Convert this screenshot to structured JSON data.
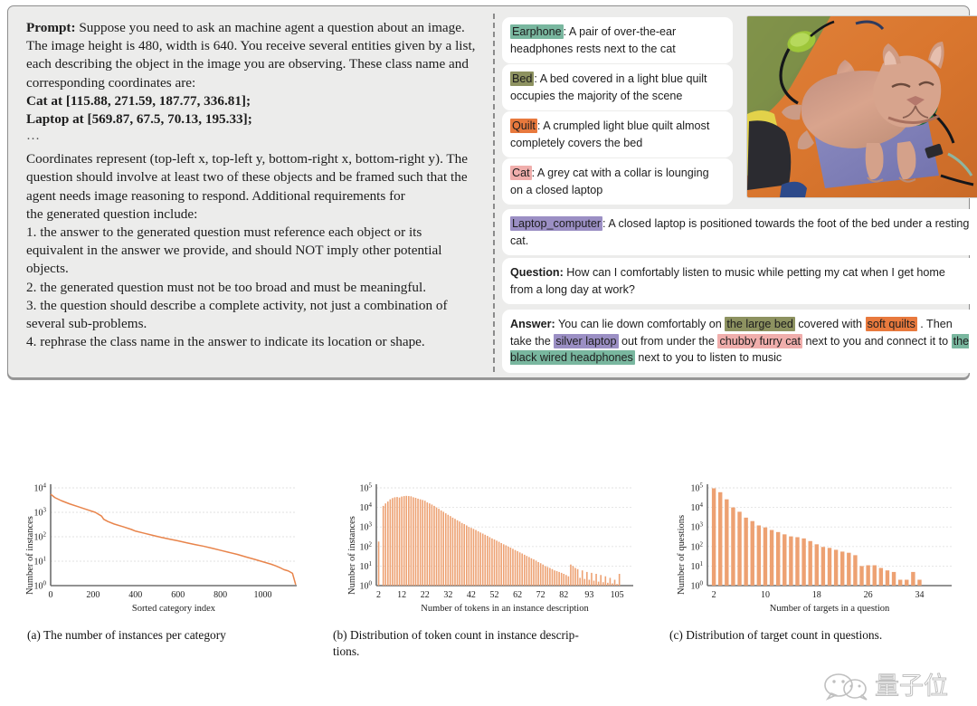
{
  "prompt": {
    "label": "Prompt:",
    "intro": " Suppose you need to ask an machine agent a question about an image. The image height is 480, width is 640. You receive several entities given by a list, each describing the object in the image you are observing. These class name and corresponding coordinates are:",
    "entity_lines": [
      "Cat at [115.88, 271.59, 187.77, 336.81];",
      "Laptop at [569.87, 67.5, 70.13, 195.33];"
    ],
    "ellipsis": "…",
    "body": "Coordinates represent (top-left x, top-left y, bottom-right x, bottom-right y). The question should involve at least two of these objects and be framed such that the agent needs image reasoning to respond. Additional requirements for",
    "body2": "the generated question include:",
    "requirements": [
      "1. the answer to the generated question must reference each object or its equivalent in the answer we provide, and should NOT imply other potential objects.",
      "2. the generated question must not be too broad and must be meaningful.",
      "3. the question should describe a complete activity, not just a combination of several sub-problems.",
      "4. rephrase the class name in the answer to indicate its location or shape."
    ]
  },
  "entities": [
    {
      "name": "Earphone",
      "color": "#79b79f",
      "sep": ":",
      "text": " A pair of over-the-ear headphones rests next to the cat"
    },
    {
      "name": "Bed",
      "color": "#8d9260",
      "sep": ":",
      "text": " A bed covered in a light blue quilt occupies the majority of the scene"
    },
    {
      "name": "Quilt",
      "color": "#e8793d",
      "sep": ":",
      "text": " A crumpled light blue quilt almost completely covers the bed"
    },
    {
      "name": "Cat",
      "color": "#f0aeac",
      "sep": ":",
      "text": " A grey cat with a collar is lounging on a closed laptop"
    },
    {
      "name": "Laptop_computer",
      "color": "#9b8fc4",
      "sep": ":",
      "text": " A closed laptop  is positioned towards the foot of the bed under a resting cat."
    }
  ],
  "question": {
    "label": "Question:",
    "text": " How can I comfortably listen to music while petting my cat when I get home from a long day at work?"
  },
  "answer": {
    "label": "Answer:",
    "seg1": " You can lie down comfortably on ",
    "hl1": "the large bed",
    "hl1_color": "#8d9260",
    "seg2": " covered with ",
    "hl2": "soft quilts",
    "hl2_color": "#e8793d",
    "seg3": " . Then take the ",
    "hl3": "silver laptop",
    "hl3_color": "#9b8fc4",
    "seg4": "  out from under the ",
    "hl4": "chubby furry cat",
    "hl4_color": "#f0aeac",
    "seg5": "  next to you and connect it to ",
    "hl5": "the black wired headphones",
    "hl5_color": "#79b79f",
    "seg6": " next to you to listen to music"
  },
  "photo": {
    "alt_name": "cat-on-laptop-photo",
    "scene": "An orange tabby cat resting on a closed purple laptop, on an orange bed quilt with green over-ear headphones at right and an olive-green quilt at top-left"
  },
  "captions": {
    "a": "(a) The number of instances per category",
    "b": "(b) Distribution of token count in instance descrip-­tions.",
    "b_line1": "(b) Distribution of token count in instance descrip-",
    "b_line2": "tions.",
    "c": "(c)  Distribution of target count in questions."
  },
  "watermark": {
    "text": "量子位"
  },
  "colors": {
    "orange": "#e8955e",
    "panel_bg": "#ececeb",
    "panel_border": "#8d8d8d",
    "axis": "#6e6e6e",
    "grid": "#dcdcdc"
  },
  "chart_data": [
    {
      "type": "line",
      "title": "(a) The number of instances per category",
      "xlabel": "Sorted category index",
      "ylabel": "Number of instances",
      "yscale": "log",
      "ylim": [
        1,
        10000
      ],
      "yticks": [
        "10^0",
        "10^1",
        "10^2",
        "10^3",
        "10^4"
      ],
      "ytick_values": [
        1,
        10,
        100,
        1000,
        10000
      ],
      "xlim": [
        0,
        1160
      ],
      "xticks": [
        0,
        200,
        400,
        600,
        800,
        1000
      ],
      "grid": true,
      "series": [
        {
          "name": "instances per sorted category",
          "color": "#e8844b",
          "x": [
            0,
            20,
            50,
            90,
            130,
            170,
            210,
            240,
            250,
            270,
            300,
            340,
            380,
            400,
            440,
            480,
            520,
            560,
            600,
            640,
            680,
            720,
            760,
            800,
            840,
            880,
            920,
            960,
            1000,
            1040,
            1060,
            1080,
            1100,
            1120,
            1140,
            1155
          ],
          "y": [
            5500,
            4000,
            3000,
            2200,
            1700,
            1300,
            1000,
            700,
            520,
            420,
            330,
            260,
            200,
            170,
            140,
            115,
            95,
            80,
            68,
            57,
            48,
            41,
            34,
            28,
            23,
            19,
            15,
            12,
            9.5,
            7.5,
            6.5,
            5.5,
            4.5,
            4,
            3.2,
            1.1
          ]
        }
      ]
    },
    {
      "type": "bar",
      "title": "(b) Distribution of token count in instance descriptions.",
      "xlabel": "Number of tokens in an instance description",
      "ylabel": "Number of instances",
      "yscale": "log",
      "ylim": [
        1,
        100000
      ],
      "yticks": [
        "10^0",
        "10^1",
        "10^2",
        "10^3",
        "10^4",
        "10^5"
      ],
      "ytick_values": [
        1,
        10,
        100,
        1000,
        10000,
        100000
      ],
      "xticks": [
        2,
        12,
        22,
        32,
        42,
        52,
        62,
        72,
        82,
        93,
        105
      ],
      "xlim": [
        1,
        112
      ],
      "grid": true,
      "bar_color": "#eda172",
      "categories": [
        2,
        3,
        4,
        5,
        6,
        7,
        8,
        9,
        10,
        11,
        12,
        13,
        14,
        15,
        16,
        17,
        18,
        19,
        20,
        21,
        22,
        23,
        24,
        25,
        26,
        27,
        28,
        29,
        30,
        31,
        32,
        33,
        34,
        35,
        36,
        37,
        38,
        39,
        40,
        41,
        42,
        43,
        44,
        45,
        46,
        47,
        48,
        49,
        50,
        51,
        52,
        53,
        54,
        55,
        56,
        57,
        58,
        59,
        60,
        61,
        62,
        63,
        64,
        65,
        66,
        67,
        68,
        69,
        70,
        71,
        72,
        73,
        74,
        75,
        76,
        77,
        78,
        79,
        80,
        81,
        82,
        83,
        84,
        85,
        86,
        87,
        88,
        89,
        90,
        91,
        92,
        93,
        94,
        95,
        96,
        97,
        98,
        99,
        100,
        101,
        102,
        103,
        104,
        105,
        106,
        107,
        108,
        109,
        110
      ],
      "values": [
        180,
        1,
        12000,
        16000,
        20000,
        26000,
        30000,
        33000,
        34000,
        32000,
        36000,
        38000,
        39000,
        38000,
        37000,
        33000,
        31000,
        28000,
        26000,
        24000,
        22000,
        18000,
        16000,
        14000,
        12000,
        10000,
        8500,
        7000,
        6000,
        5000,
        4200,
        3600,
        3000,
        2600,
        2200,
        1900,
        1600,
        1400,
        1200,
        1000,
        900,
        800,
        700,
        600,
        520,
        460,
        400,
        350,
        300,
        260,
        230,
        200,
        175,
        150,
        130,
        115,
        100,
        88,
        76,
        66,
        58,
        50,
        44,
        38,
        33,
        29,
        25,
        22,
        19,
        16,
        14,
        12,
        10,
        9,
        8,
        7,
        6,
        5.5,
        5,
        4.5,
        4,
        3.5,
        3,
        12,
        10,
        8,
        7,
        2.5,
        6,
        2.2,
        5,
        2,
        4.5,
        1.8,
        4,
        1.6,
        3.5,
        1.5,
        3,
        1.4,
        2.5,
        1.3,
        2,
        1.2,
        4,
        1,
        1,
        1,
        1,
        1
      ]
    },
    {
      "type": "bar",
      "title": "(c) Distribution of target count in questions.",
      "xlabel": "Number of targets in a question",
      "ylabel": "Number of questions",
      "yscale": "log",
      "ylim": [
        1,
        100000
      ],
      "yticks": [
        "10^0",
        "10^1",
        "10^2",
        "10^3",
        "10^4",
        "10^5"
      ],
      "ytick_values": [
        1,
        10,
        100,
        1000,
        10000,
        100000
      ],
      "xticks": [
        2,
        10,
        18,
        26,
        34
      ],
      "xlim": [
        1,
        39
      ],
      "grid": true,
      "bar_color": "#eda172",
      "categories": [
        2,
        3,
        4,
        5,
        6,
        7,
        8,
        9,
        10,
        11,
        12,
        13,
        14,
        15,
        16,
        17,
        18,
        19,
        20,
        21,
        22,
        23,
        24,
        25,
        26,
        27,
        28,
        29,
        30,
        31,
        32,
        33,
        34
      ],
      "values": [
        95000,
        60000,
        26000,
        10000,
        6000,
        3000,
        2000,
        1200,
        950,
        700,
        550,
        420,
        330,
        300,
        260,
        190,
        130,
        95,
        85,
        68,
        55,
        48,
        36,
        10,
        11,
        11,
        8,
        6,
        5,
        2,
        2,
        5,
        2,
        4
      ]
    }
  ]
}
